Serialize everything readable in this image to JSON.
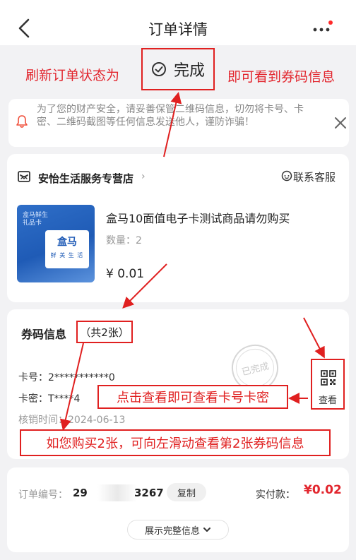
{
  "header": {
    "title": "订单详情"
  },
  "status": {
    "label": "完成"
  },
  "annotations": {
    "refresh_status": "刷新订单状态为",
    "view_coupon": "即可看到券码信息",
    "click_view": "点击查看即可查看卡号卡密",
    "swipe_left": "如您购买2张，可向左滑动查看第2张券码信息"
  },
  "notice": {
    "text": "为了您的财产安全，请妥善保管二维码信息，切勿将卡号、卡密、二维码截图等任何信息发送他人，谨防诈骗！"
  },
  "shop": {
    "name": "安怡生活服务专营店",
    "chevron": "›",
    "customer_service": "联系客服"
  },
  "product": {
    "thumb_small_text": "盒马鲜生\n礼品卡",
    "thumb_brand": "盒马",
    "thumb_slogan": "鲜 美 生 活",
    "title": "盒马10面值电子卡测试商品请勿购买",
    "quantity": "数量：2",
    "price": "¥ 0.01"
  },
  "coupon": {
    "title": "券码信息",
    "count": "（共2张）",
    "card_no": "卡号：2***********0",
    "card_pw": "卡密：T****4",
    "redeem_time": "核销时间：2024-06-13",
    "seal_text": "已完成",
    "view_label": "查看"
  },
  "order": {
    "number_label": "订单编号：",
    "number_head": "29",
    "number_tail": "3267",
    "copy_label": "复制",
    "paid_label": "实付款：",
    "paid_value": "¥0.02",
    "expand_label": "展示完整信息"
  },
  "colors": {
    "annotation_red": "#e02020",
    "price_red": "#e2262e",
    "background": "#f2f2f4"
  },
  "icons": [
    "back-arrow-icon",
    "more-dots-icon",
    "check-circle-icon",
    "bell-icon",
    "close-icon",
    "shop-icon",
    "customer-service-icon",
    "qr-code-icon",
    "chevron-down-icon"
  ]
}
